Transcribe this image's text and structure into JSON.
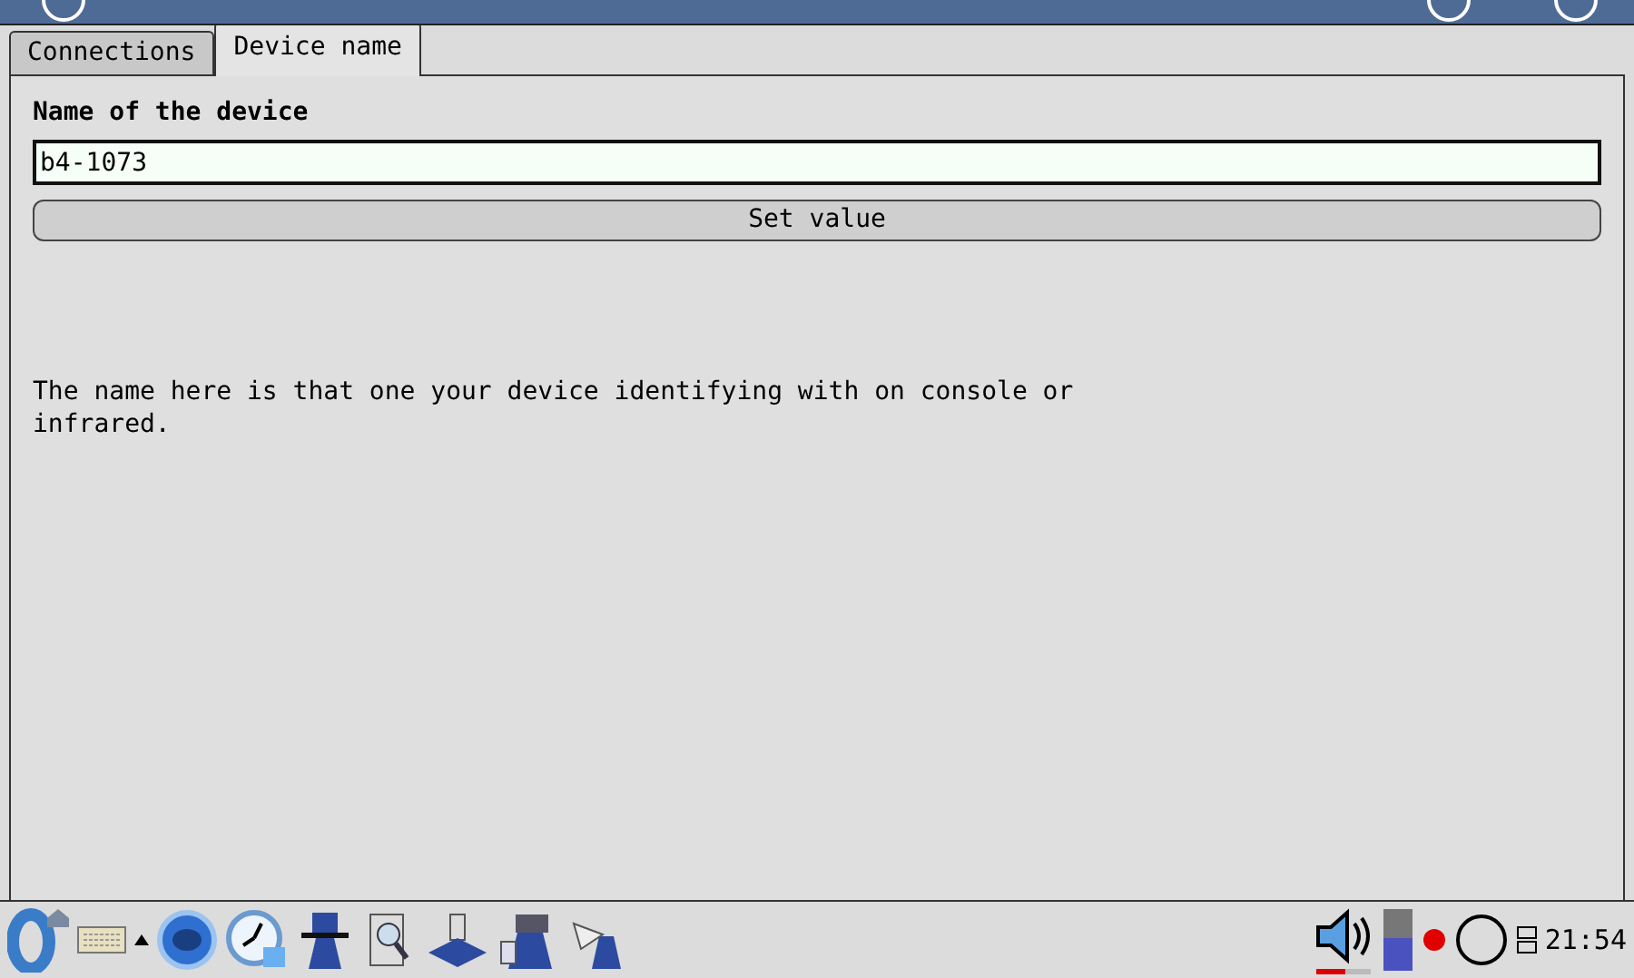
{
  "tabs": [
    {
      "label": "Connections",
      "selected": false
    },
    {
      "label": "Device name",
      "selected": true
    }
  ],
  "field": {
    "label": "Name of the device",
    "value": "b4-1073"
  },
  "button": "Set value",
  "description": "The name here is that one your device identifying with on console or infrared.",
  "tray": {
    "clock": "21:54"
  }
}
